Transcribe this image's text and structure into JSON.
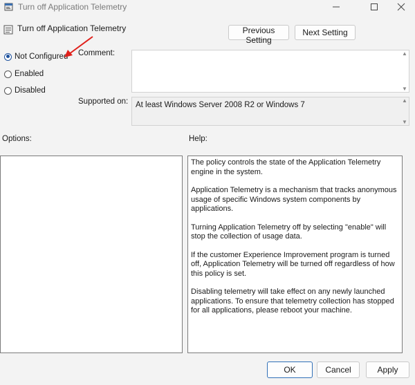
{
  "window": {
    "title": "Turn off Application Telemetry",
    "controls": {
      "minimize_icon": "minimize-icon",
      "maximize_icon": "maximize-icon",
      "close_icon": "close-icon"
    }
  },
  "header": {
    "policy_title": "Turn off Application Telemetry",
    "previous_label": "Previous Setting",
    "next_label": "Next Setting"
  },
  "state": {
    "options": [
      {
        "label": "Not Configured",
        "checked": true
      },
      {
        "label": "Enabled",
        "checked": false
      },
      {
        "label": "Disabled",
        "checked": false
      }
    ]
  },
  "comment": {
    "label": "Comment:",
    "value": ""
  },
  "supported": {
    "label": "Supported on:",
    "value": "At least Windows Server 2008 R2 or Windows 7"
  },
  "options_panel": {
    "label": "Options:"
  },
  "help_panel": {
    "label": "Help:",
    "paragraphs": [
      "The policy controls the state of the Application Telemetry engine in the system.",
      "Application Telemetry is a mechanism that tracks anonymous usage of specific Windows system components by applications.",
      "Turning Application Telemetry off by selecting \"enable\" will stop the collection of usage data.",
      "If the customer Experience Improvement program is turned off, Application Telemetry will be turned off regardless of how this policy is set.",
      "Disabling telemetry will take effect on any newly launched applications. To ensure that telemetry collection has stopped for all applications, please reboot your machine."
    ]
  },
  "footer": {
    "ok_label": "OK",
    "cancel_label": "Cancel",
    "apply_label": "Apply"
  },
  "colors": {
    "accent": "#1a4f9c",
    "annotation_arrow": "#e0201b"
  }
}
